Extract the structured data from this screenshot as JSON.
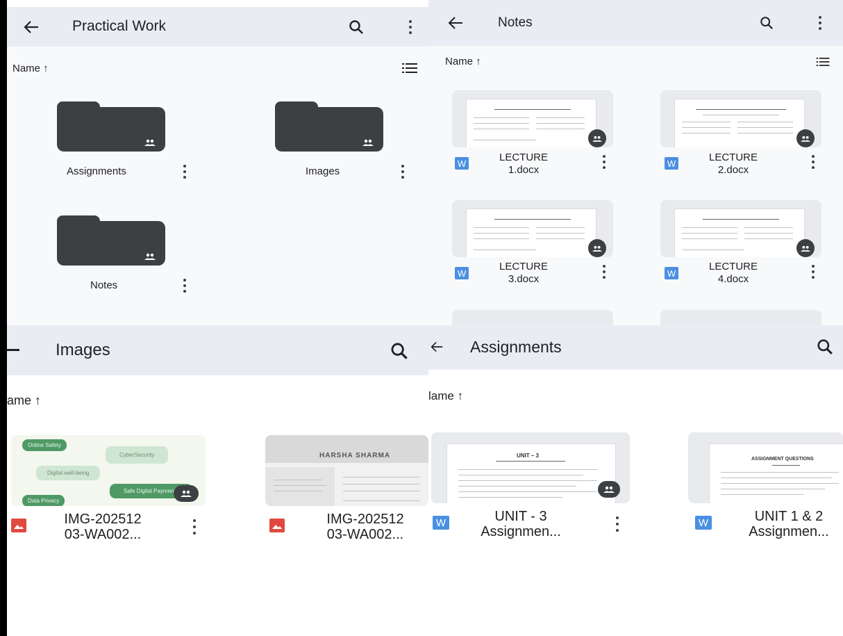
{
  "practical": {
    "title": "Practical Work",
    "sort": "Name ↑",
    "folders": [
      {
        "name": "Assignments"
      },
      {
        "name": "Images"
      },
      {
        "name": "Notes"
      }
    ]
  },
  "notes": {
    "title": "Notes",
    "sort": "Name ↑",
    "files": [
      {
        "line1": "LECTURE",
        "line2": "1.docx",
        "badge": "W"
      },
      {
        "line1": "LECTURE",
        "line2": "2.docx",
        "badge": "W"
      },
      {
        "line1": "LECTURE",
        "line2": "3.docx",
        "badge": "W"
      },
      {
        "line1": "LECTURE",
        "line2": "4.docx",
        "badge": "W"
      }
    ]
  },
  "images": {
    "title": "Images",
    "sort": "ame ↑",
    "files": [
      {
        "line1": "IMG-202512",
        "line2": "03-WA002..."
      },
      {
        "line1": "IMG-202512",
        "line2": "03-WA002..."
      }
    ],
    "thumb1_bubbles": [
      "Online Safety",
      "CyberSecurity",
      "Digital well-being",
      "Safe Digital Payments",
      "Data Privacy"
    ],
    "thumb2_title": "HARSHA SHARMA"
  },
  "assignments": {
    "title": "Assignments",
    "sort": "lame ↑",
    "files": [
      {
        "line1": "UNIT - 3",
        "line2": "Assignmen...",
        "badge": "W"
      },
      {
        "line1": "UNIT 1 & 2",
        "line2": "Assignmen...",
        "badge": "W"
      }
    ],
    "doc1_heading": "UNIT – 3",
    "doc2_heading": "ASSIGNMENT QUESTIONS"
  },
  "colors": {
    "topbar": "#e9edf3",
    "folder": "#3c4043",
    "word": "#4a90e2",
    "image": "#e04a3f"
  }
}
